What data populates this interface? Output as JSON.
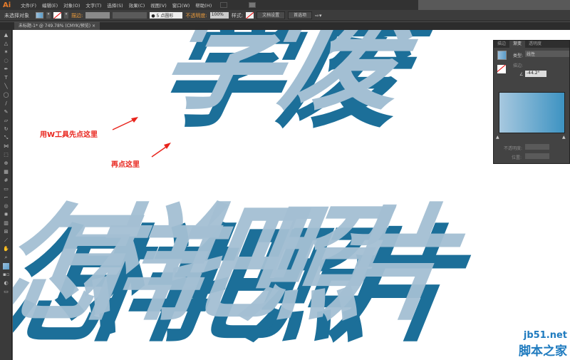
{
  "app": {
    "logo": "Ai",
    "menus": [
      "文件(F)",
      "编辑(E)",
      "对象(O)",
      "文字(T)",
      "选择(S)",
      "效果(C)",
      "视图(V)",
      "窗口(W)",
      "帮助(H)"
    ]
  },
  "control": {
    "selection": "未选择对象",
    "stroke_label": "描边:",
    "brush": "● 5 点圆形",
    "opacity_label": "不透明度:",
    "opacity": "100%",
    "style_label": "样式:",
    "doc_setup": "文档设置",
    "preferences": "首选项"
  },
  "document_tab": {
    "title": "未标题-1* @ 749.78% (CMYK/预览)",
    "close": "×"
  },
  "panel": {
    "tabs": [
      "描边",
      "渐变",
      "透明度"
    ],
    "type_label": "类型:",
    "type_value": "线性",
    "stroke_label": "描边:",
    "angle": "-44.2°",
    "opacity_label": "不透明度:",
    "position_label": "位置:"
  },
  "artwork": {
    "top_text": "学废",
    "bottom_text": "怎样把照片",
    "light": "#a3bfd3",
    "dark": "#1c6f99"
  },
  "annotations": {
    "first": "用W工具先点这里",
    "second": "再点这里"
  },
  "watermark": {
    "site": "jb51.net",
    "name": "脚本之家"
  }
}
